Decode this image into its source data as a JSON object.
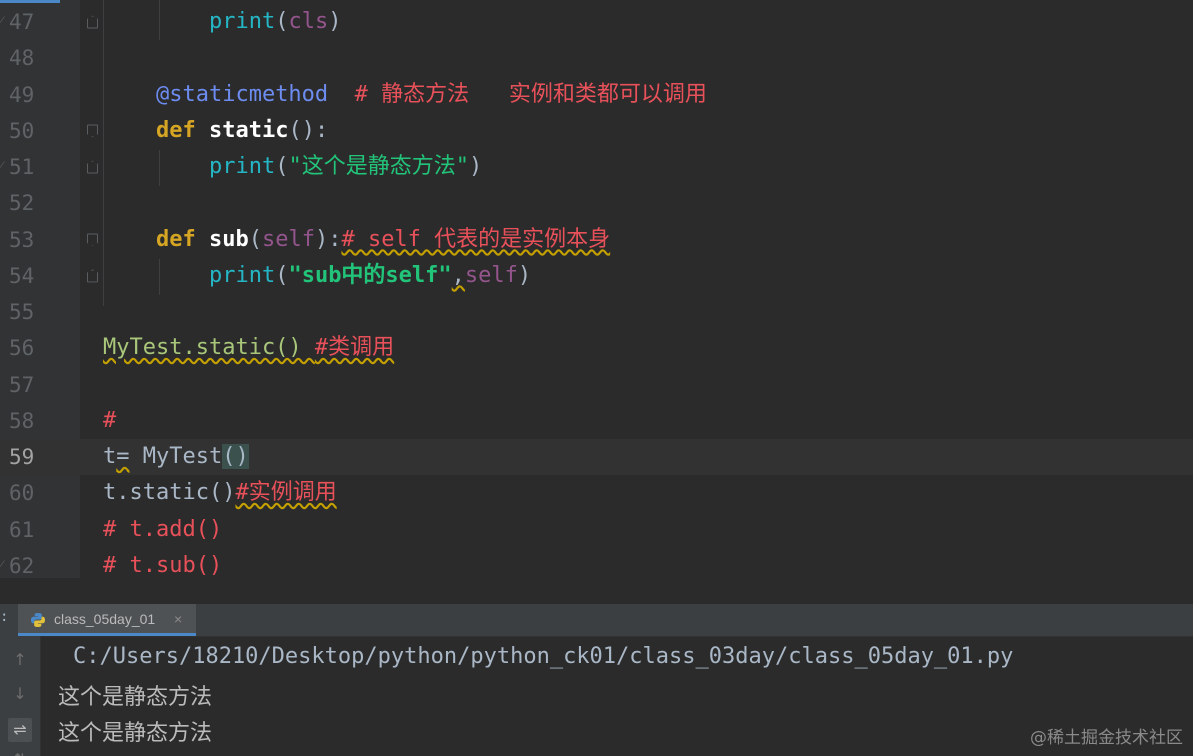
{
  "editor": {
    "lines": [
      {
        "num": "47",
        "current": false,
        "fold": "open",
        "bp": true,
        "tokens": [
          {
            "t": "        ",
            "c": "plain"
          },
          {
            "t": "print",
            "c": "builtin"
          },
          {
            "t": "(",
            "c": "plain"
          },
          {
            "t": "cls",
            "c": "selfc"
          },
          {
            "t": ")",
            "c": "plain"
          }
        ]
      },
      {
        "num": "48",
        "current": false,
        "fold": "",
        "bp": false,
        "tokens": []
      },
      {
        "num": "49",
        "current": false,
        "fold": "",
        "bp": false,
        "tokens": [
          {
            "t": "    ",
            "c": "plain"
          },
          {
            "t": "@staticmethod",
            "c": "deco"
          },
          {
            "t": "  # 静态方法   实例和类都可以调用",
            "c": "comment"
          }
        ]
      },
      {
        "num": "50",
        "current": false,
        "fold": "close",
        "bp": false,
        "tokens": [
          {
            "t": "    ",
            "c": "plain"
          },
          {
            "t": "def ",
            "c": "kwgold"
          },
          {
            "t": "static",
            "c": "fn"
          },
          {
            "t": "():",
            "c": "plain"
          }
        ]
      },
      {
        "num": "51",
        "current": false,
        "fold": "open",
        "bp": true,
        "tokens": [
          {
            "t": "        ",
            "c": "plain"
          },
          {
            "t": "print",
            "c": "builtin"
          },
          {
            "t": "(",
            "c": "plain"
          },
          {
            "t": "\"这个是静态方法\"",
            "c": "str"
          },
          {
            "t": ")",
            "c": "plain"
          }
        ]
      },
      {
        "num": "52",
        "current": false,
        "fold": "",
        "bp": false,
        "tokens": []
      },
      {
        "num": "53",
        "current": false,
        "fold": "close",
        "bp": false,
        "tokens": [
          {
            "t": "    ",
            "c": "plain"
          },
          {
            "t": "def ",
            "c": "kwgold"
          },
          {
            "t": "sub",
            "c": "fn"
          },
          {
            "t": "(",
            "c": "plain"
          },
          {
            "t": "self",
            "c": "selfc"
          },
          {
            "t": "):",
            "c": "plain"
          },
          {
            "t": "# self 代表的是实例本身",
            "c": "comment wavy"
          }
        ]
      },
      {
        "num": "54",
        "current": false,
        "fold": "open",
        "bp": false,
        "tokens": [
          {
            "t": "        ",
            "c": "plain"
          },
          {
            "t": "print",
            "c": "builtin"
          },
          {
            "t": "(",
            "c": "plain"
          },
          {
            "t": "\"sub中的self\"",
            "c": "strb"
          },
          {
            "t": ",",
            "c": "plain wavy"
          },
          {
            "t": "self",
            "c": "selfc"
          },
          {
            "t": ")",
            "c": "plain"
          }
        ]
      },
      {
        "num": "55",
        "current": false,
        "fold": "",
        "bp": false,
        "tokens": []
      },
      {
        "num": "56",
        "current": false,
        "fold": "",
        "bp": false,
        "tokens": [
          {
            "t": "MyTest.static() ",
            "c": "green wavy"
          },
          {
            "t": "#类调用",
            "c": "comment wavy"
          }
        ]
      },
      {
        "num": "57",
        "current": false,
        "fold": "",
        "bp": false,
        "tokens": []
      },
      {
        "num": "58",
        "current": false,
        "fold": "",
        "bp": false,
        "tokens": [
          {
            "t": "#",
            "c": "comment"
          }
        ]
      },
      {
        "num": "59",
        "current": true,
        "fold": "",
        "bp": false,
        "tokens": [
          {
            "t": "t",
            "c": "plain"
          },
          {
            "t": "=",
            "c": "plain wavy"
          },
          {
            "t": " MyTest",
            "c": "plain"
          },
          {
            "t": "()",
            "c": "plain brace-hl"
          }
        ]
      },
      {
        "num": "60",
        "current": false,
        "fold": "",
        "bp": false,
        "tokens": [
          {
            "t": "t.static()",
            "c": "plain"
          },
          {
            "t": "#实例调用",
            "c": "comment wavy"
          }
        ]
      },
      {
        "num": "61",
        "current": false,
        "fold": "",
        "bp": false,
        "tokens": [
          {
            "t": "# t.add()",
            "c": "comment"
          }
        ]
      },
      {
        "num": "62",
        "current": false,
        "fold": "",
        "bp": true,
        "tokens": [
          {
            "t": "# t.sub()",
            "c": "comment"
          }
        ]
      }
    ]
  },
  "run_panel": {
    "tab_prefix": ":",
    "tab_label": "class_05day_01",
    "tab_close": "×",
    "toolbar": {
      "up": "↑",
      "down": "↓",
      "wrap": "⇌",
      "more": "⇅"
    },
    "console": {
      "path": "C:/Users/18210/Desktop/python/python_ck01/class_03day/class_05day_01.py",
      "out1": "这个是静态方法",
      "out2": "这个是静态方法"
    },
    "watermark": "@稀土掘金技术社区"
  },
  "colors": {
    "editor_bg": "#2b2b2b",
    "gutter_bg": "#313335",
    "keyword": "#d5a523",
    "comment": "#e8515a",
    "string": "#22c47a",
    "builtin": "#25b6c6",
    "self": "#94558d",
    "decorator": "#6d8cf0"
  }
}
